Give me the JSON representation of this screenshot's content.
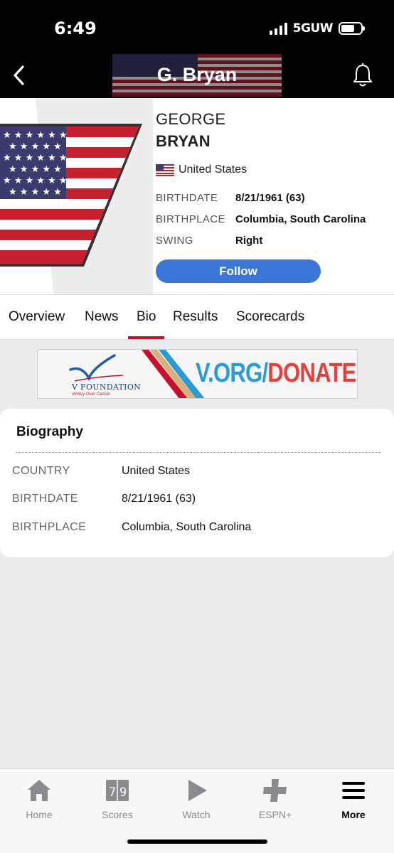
{
  "status_bar": {
    "time": "6:49",
    "network": "5GUW"
  },
  "header": {
    "title": "G. Bryan"
  },
  "player": {
    "first_name": "GEORGE",
    "last_name": "BRYAN",
    "country": "United States",
    "birthdate_label": "BIRTHDATE",
    "birthdate": "8/21/1961 (63)",
    "birthplace_label": "BIRTHPLACE",
    "birthplace": "Columbia, South Carolina",
    "swing_label": "SWING",
    "swing": "Right",
    "follow_label": "Follow"
  },
  "tabs": [
    {
      "label": "Overview"
    },
    {
      "label": "News"
    },
    {
      "label": "Bio",
      "active": true
    },
    {
      "label": "Results"
    },
    {
      "label": "Scorecards"
    }
  ],
  "ad": {
    "logo_name": "V FOUNDATION",
    "logo_tagline": "Victory Over Cancer",
    "cta_part1": "V.ORG/",
    "cta_part2": "DONATE"
  },
  "biography": {
    "title": "Biography",
    "rows": [
      {
        "label": "COUNTRY",
        "value": "United States"
      },
      {
        "label": "BIRTHDATE",
        "value": "8/21/1961 (63)"
      },
      {
        "label": "BIRTHPLACE",
        "value": "Columbia, South Carolina"
      }
    ]
  },
  "bottom_nav": [
    {
      "label": "Home",
      "icon": "home-icon"
    },
    {
      "label": "Scores",
      "icon": "scores-icon"
    },
    {
      "label": "Watch",
      "icon": "play-icon"
    },
    {
      "label": "ESPN+",
      "icon": "plus-icon"
    },
    {
      "label": "More",
      "icon": "menu-icon",
      "active": true
    }
  ],
  "colors": {
    "accent_red": "#c8102e",
    "follow_blue": "#3a77d8"
  }
}
